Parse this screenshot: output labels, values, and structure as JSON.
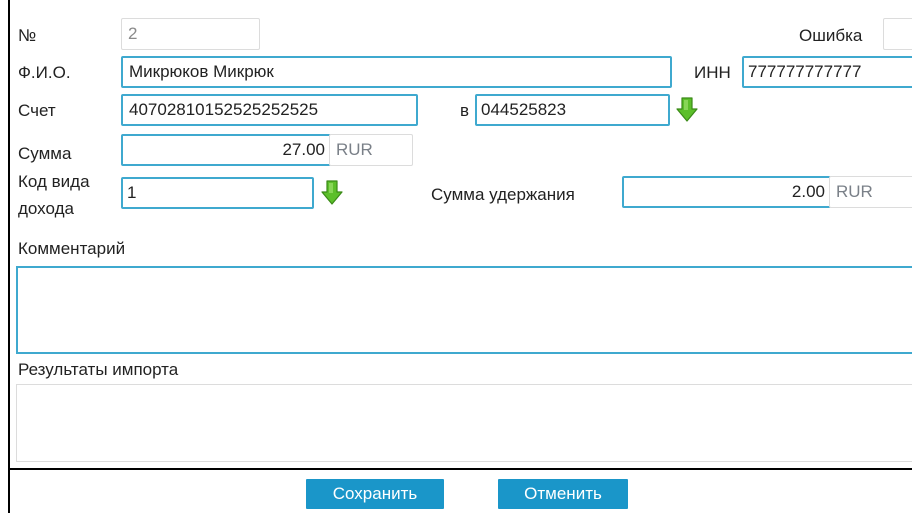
{
  "form": {
    "number": {
      "label": "№",
      "value": "2"
    },
    "error": {
      "label": "Ошибка",
      "value": ""
    },
    "fio": {
      "label": "Ф.И.О.",
      "value": "Микрюков Микрюк"
    },
    "inn": {
      "label": "ИНН",
      "value": "777777777777"
    },
    "account": {
      "label": "Счет",
      "value": "40702810152525252525"
    },
    "bank": {
      "label": "в",
      "value": "044525823"
    },
    "amount": {
      "label": "Сумма",
      "value": "27.00",
      "currency": "RUR"
    },
    "income_code": {
      "label_line1": "Код вида",
      "label_line2": "дохода",
      "value": "1"
    },
    "withholding": {
      "label": "Сумма удержания",
      "value": "2.00",
      "currency": "RUR"
    },
    "comment": {
      "label": "Комментарий",
      "value": ""
    },
    "import_results": {
      "label": "Результаты импорта",
      "value": ""
    }
  },
  "buttons": {
    "save": "Сохранить",
    "cancel": "Отменить"
  },
  "colors": {
    "field_border": "#3fa9cf",
    "button_bg": "#1a96c9",
    "arrow_green": "#5cbf2a"
  },
  "icons": {
    "picker": "green-down-arrow-icon"
  }
}
